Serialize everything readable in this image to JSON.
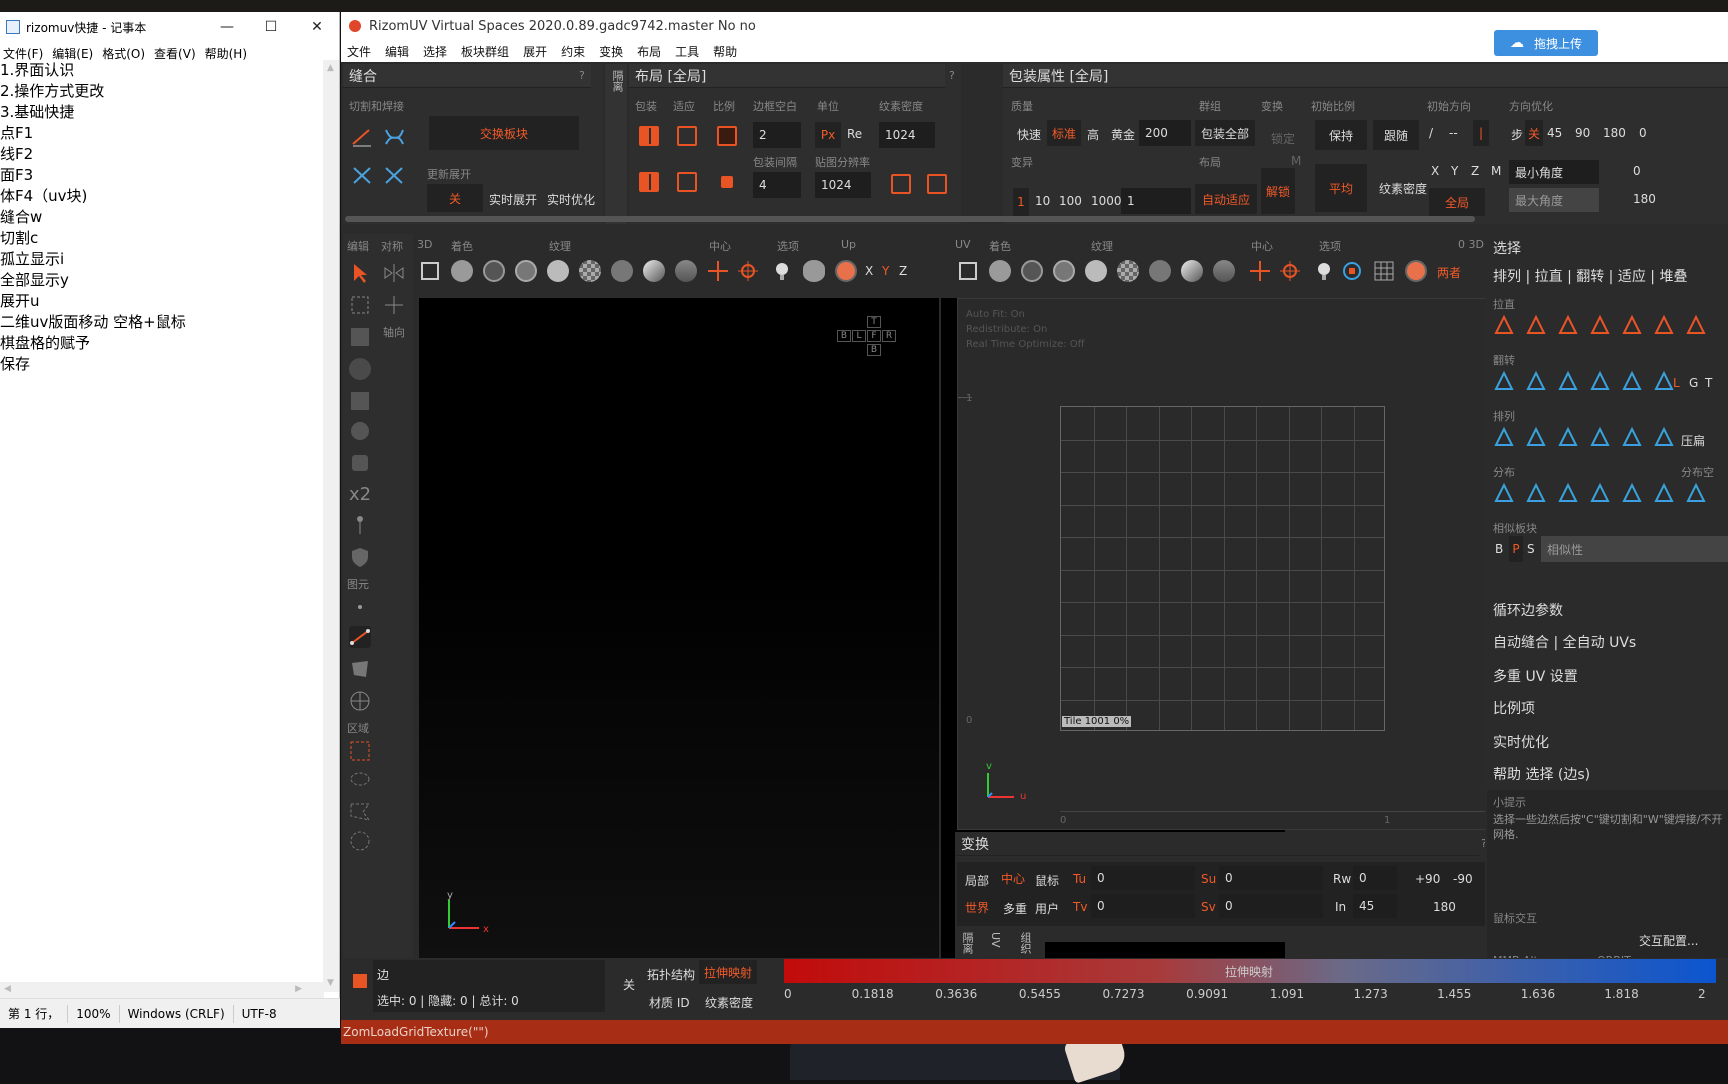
{
  "notepad": {
    "title": "rizomuv快捷 - 记事本",
    "menu": [
      "文件(F)",
      "编辑(E)",
      "格式(O)",
      "查看(V)",
      "帮助(H)"
    ],
    "lines": [
      "1.界面认识",
      "2.操作方式更改",
      "3.基础快捷",
      "点F1",
      "线F2",
      "面F3",
      "体F4（uv块)",
      "缝合w",
      "切割c",
      "孤立显示i",
      "全部显示y",
      "展开u",
      "二维uv版面移动 空格+鼠标",
      "棋盘格的赋予",
      "保存"
    ],
    "status": [
      "第 1 行，",
      "100%",
      "Windows (CRLF)",
      "UTF-8"
    ]
  },
  "rizom": {
    "title": "RizomUV  Virtual Spaces 2020.0.89.gadc9742.master No no",
    "menu": [
      "文件",
      "编辑",
      "选择",
      "板块群组",
      "展开",
      "约束",
      "变换",
      "布局",
      "工具",
      "帮助"
    ],
    "upload_label": "拖拽上传",
    "seam": {
      "header": "缝合",
      "help": "?",
      "cut_weld": "切割和焊接",
      "swap_islands": "交换板块",
      "update_unfold": "更新展开",
      "off": "关",
      "realtime_unfold": "实时展开",
      "realtime_optimize": "实时优化",
      "side_tab": "隔离"
    },
    "layout": {
      "header": "布局 [全局]",
      "help": "?",
      "labels": [
        "包装",
        "适应",
        "比例",
        "边框空白",
        "单位",
        "纹素密度",
        "包装间隔",
        "贴图分辨率"
      ],
      "margin": "2",
      "spacing": "4",
      "px": "Px",
      "re": "Re",
      "texel": "1024",
      "map_res": "1024"
    },
    "pack": {
      "header": "包装属性 [全局]",
      "labels": [
        "质量",
        "群组",
        "变换",
        "初始比例",
        "初始方向",
        "方向优化",
        "变异",
        "布局"
      ],
      "quality": [
        "快速",
        "标准",
        "高",
        "黄金"
      ],
      "quality_value": "200",
      "pack_all": "包装全部",
      "lock": "锁定",
      "keep": "保持",
      "follow": "跟随",
      "variation": [
        "1",
        "10",
        "100",
        "1000"
      ],
      "variation_value": "1",
      "auto_fit": "自动适应",
      "unlock": "解锁",
      "m": "M",
      "average": "平均",
      "texel": "纹素密度",
      "xyz": [
        "X",
        "Y",
        "Z",
        "M"
      ],
      "global": "全局",
      "dir_slash": "/",
      "dir_dash": "--",
      "dir_bar": "|",
      "step": "步",
      "step_off": "关",
      "angles": [
        "45",
        "90",
        "180",
        "0"
      ],
      "min_angle": "最小角度",
      "min_angle_value": "0",
      "max_angle": "最大角度",
      "max_angle_value": "180"
    },
    "left_tools": {
      "labels": [
        "编辑",
        "对称",
        "轴向",
        "图元",
        "区域"
      ],
      "x2": "x2"
    },
    "viewport3d": {
      "tabs": [
        "3D",
        "着色",
        "纹理",
        "中心",
        "选项",
        "Up"
      ],
      "axes": [
        "X",
        "Y",
        "Z"
      ],
      "cube": [
        "T",
        "B",
        "L",
        "F",
        "R",
        "B"
      ]
    },
    "uv_view": {
      "tabs": [
        "UV",
        "着色",
        "纹理",
        "中心",
        "选项",
        "0 3D"
      ],
      "both": "两者",
      "info": [
        "Auto Fit: On",
        "Redistribute: On",
        "Real Time Optimize: Off"
      ],
      "tile_label": "Tile 1001 0%",
      "axis_1": "1",
      "axis_0": "0",
      "bottom_0": "0",
      "bottom_1": "1",
      "u": "u",
      "v": "v"
    },
    "transform": {
      "header": "变换",
      "help": "?",
      "row1": [
        "局部",
        "中心",
        "鼠标"
      ],
      "row2": [
        "世界",
        "多重",
        "用户"
      ],
      "tu": "Tu",
      "tu_value": "0",
      "tv": "Tv",
      "tv_value": "0",
      "su": "Su",
      "su_value": "0",
      "sv": "Sv",
      "sv_value": "0",
      "rw": "Rw",
      "rw_value": "0",
      "in": "In",
      "in_value": "45",
      "plus90": "+90",
      "minus90": "-90",
      "r180": "180",
      "side_tabs": [
        "隔离",
        "UV",
        "组织"
      ]
    },
    "right_panel": {
      "header": "选择",
      "tabs_line": "排列 | 拉直 | 翻转 | 适应 | 堆叠",
      "sections": [
        "拉直",
        "翻转",
        "排列",
        "分布",
        "相似板块"
      ],
      "distribute_right": "分布空",
      "compress": "压扁",
      "flip_letters": [
        "L",
        "G",
        "T"
      ],
      "bps": [
        "B",
        "P",
        "S"
      ],
      "similarity": "相似性",
      "items": [
        "循环边参数",
        "自动缝合 | 全自动 UVs",
        "多重 UV 设置",
        "比例项",
        "实时优化",
        "帮助 选择 (边s)"
      ],
      "tips_title": "小提示",
      "tips_text": "选择一些边然后按\"C\"键切割和\"W\"键焊接/不开网格.",
      "mouse": "鼠标交互",
      "interact_config": "交互配置...",
      "mmb": "MMB Alt",
      "orbit": "ORBIT"
    },
    "bottom": {
      "mode": "边",
      "counts": "选中: 0 | 隐藏: 0 | 总计: 0",
      "off": "关",
      "topology": "拓扑结构",
      "stretch": "拉伸映射",
      "material": "材质 ID",
      "texel": "纹素密度",
      "gradient_label": "拉伸映射",
      "scale": [
        "0",
        "0.1818",
        "0.3636",
        "0.5455",
        "0.7273",
        "0.9091",
        "1.091",
        "1.273",
        "1.455",
        "1.636",
        "1.818",
        "2"
      ]
    },
    "status_cmd": "ZomLoadGridTexture(\"\")",
    "colors": {
      "accent": "#f25a28",
      "upload": "#3d8fe0",
      "status": "#a72e15"
    }
  }
}
